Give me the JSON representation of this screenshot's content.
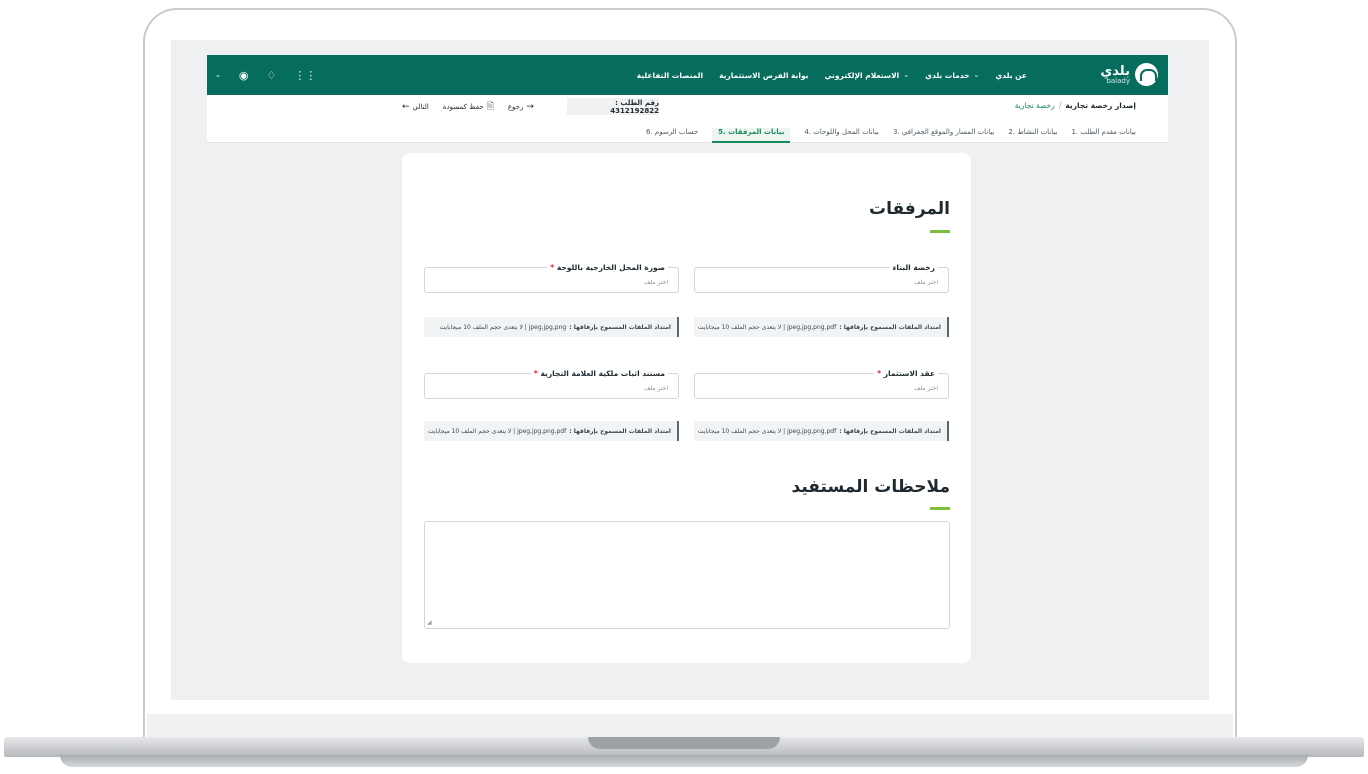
{
  "topbar": {
    "logo_ar": "بلدي",
    "logo_en": "balady",
    "nav": [
      {
        "label": "عن بلدي",
        "dropdown": false
      },
      {
        "label": "خدمات بلدي",
        "dropdown": true
      },
      {
        "label": "الاستعلام الإلكتروني",
        "dropdown": true
      },
      {
        "label": "بوابة الفرص الاستثمارية",
        "dropdown": false
      },
      {
        "label": "المنصات التفاعلية",
        "dropdown": false
      }
    ],
    "icons": [
      "grid-icon",
      "bell-icon",
      "user-icon",
      "chevron-down-icon"
    ]
  },
  "breadcrumb": {
    "main": "إصدار رخصة تجارية",
    "separator": "/",
    "current": "رخصة تجارية"
  },
  "request": {
    "label": "رقم الطلب : 4312192822"
  },
  "actions": {
    "back": "رجوع",
    "save_draft": "حفظ كمسودة",
    "next": "التالي"
  },
  "steps": [
    {
      "label": "1. بيانات مقدم الطلب",
      "active": false
    },
    {
      "label": "2. بيانات النشاط",
      "active": false
    },
    {
      "label": "3. بيانات المسار والموقع الجغرافي",
      "active": false
    },
    {
      "label": "4. بيانات المحل واللوحات",
      "active": false
    },
    {
      "label": "5. بيانات المرفقات",
      "active": true
    },
    {
      "label": "6. حساب الرسوم",
      "active": false
    }
  ],
  "attachments": {
    "title": "المرفقات",
    "file_placeholder": "اختر ملف",
    "fields": {
      "building_license": {
        "label": "رخصة البناء",
        "required": false
      },
      "shop_photo": {
        "label": "صورة المحل الخارجية باللوحة",
        "required": true
      },
      "investment_contract": {
        "label": "عقد الاستثمار",
        "required": true
      },
      "trademark_doc": {
        "label": "مستند اثبات ملكية العلامة التجارية",
        "required": true
      }
    },
    "hint_label": "امتداد الملفات المسموح بإرفاقها :",
    "hint_pdf": "jpeg,jpg,png,pdf | لا يتعدى حجم الملف 10 ميجابايت",
    "hint_img": "jpeg,jpg,png | لا يتعدى حجم الملف 10 ميجابايت",
    "required_mark": "*"
  },
  "notes": {
    "title": "ملاحظات المستفيد",
    "value": ""
  },
  "colors": {
    "brand_green": "#066c5e",
    "accent_green": "#7cbf3c",
    "active_step": "#1b8a5a",
    "required": "#d9252b"
  }
}
